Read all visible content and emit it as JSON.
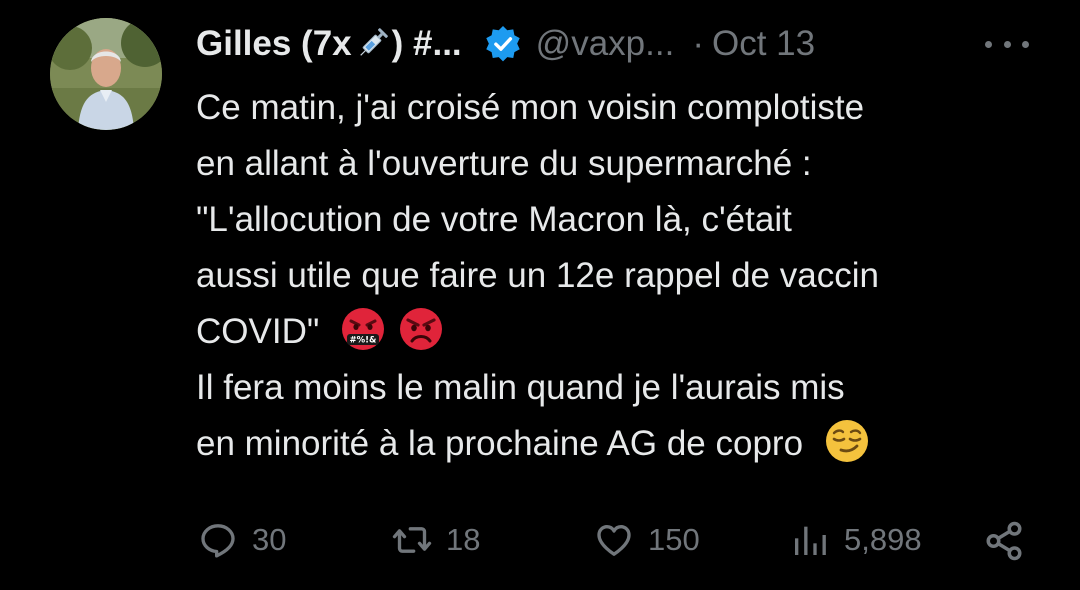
{
  "tweet": {
    "author": {
      "name_prefix": "Gilles (7x",
      "name_suffix": ") #...",
      "handle": "@vaxp...",
      "avatar_icon": "profile-photo",
      "verified_icon": "verified-badge-icon"
    },
    "separator": "·",
    "date": "Oct 13",
    "body_lines": [
      "Ce matin, j'ai croisé mon voisin complotiste",
      "en allant à l'ouverture du supermarché :",
      "\"L'allocution de votre Macron là, c'était",
      "aussi utile que faire un 12e rappel de vaccin",
      "COVID\"",
      "Il fera moins le malin quand je l'aurais mis",
      "en minorité à la prochaine AG de copro"
    ],
    "emojis": {
      "cursing_face_symbols": "#%!&"
    },
    "stats": {
      "replies": "30",
      "reposts": "18",
      "likes": "150",
      "views": "5,898"
    }
  },
  "colors": {
    "background": "#000000",
    "text": "#e7e9ea",
    "muted": "#71767b",
    "verified": "#1d9bf0",
    "angry_red": "#e0243a"
  }
}
